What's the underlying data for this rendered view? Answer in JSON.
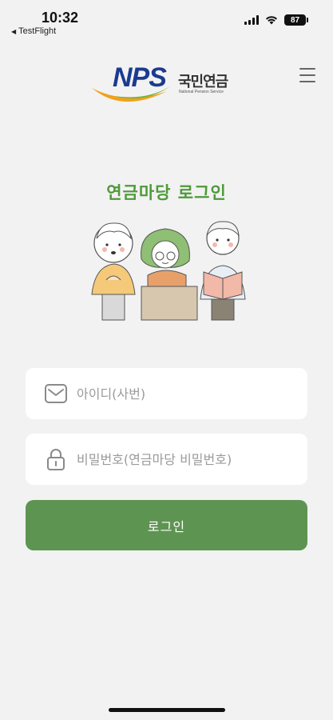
{
  "status_bar": {
    "time": "10:32",
    "back_app": "TestFlight",
    "battery": "87"
  },
  "header": {
    "logo_text": "NPS",
    "logo_korean": "국민연금",
    "logo_english": "National Pension Service",
    "brand_colors": {
      "blue": "#1b3b8f",
      "green": "#4e9a3a",
      "orange": "#f0a21c"
    }
  },
  "page": {
    "title": "연금마당 로그인"
  },
  "form": {
    "id_placeholder": "아이디(사번)",
    "password_placeholder": "비밀번호(연금마당 비밀번호)",
    "login_label": "로그인"
  },
  "colors": {
    "accent": "#5e9452",
    "title": "#4e9a3a",
    "background": "#f2f2f2"
  },
  "icons": {
    "id_field": "mail-icon",
    "password_field": "lock-icon",
    "menu": "hamburger-menu-icon"
  }
}
